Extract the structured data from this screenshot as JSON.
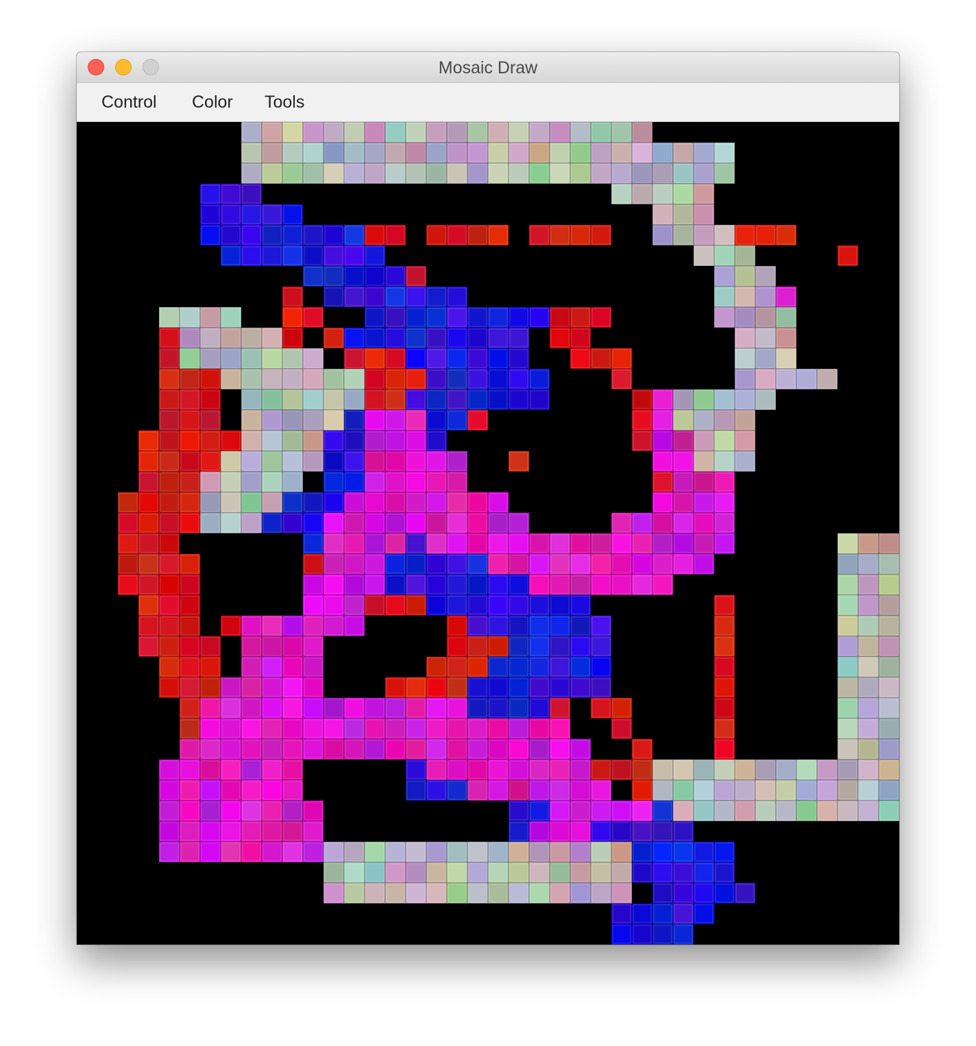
{
  "window": {
    "title": "Mosaic Draw",
    "controls": [
      "close-icon",
      "minimize-icon",
      "zoom-icon"
    ]
  },
  "menu": {
    "items": [
      {
        "label": "Control"
      },
      {
        "label": "Color"
      },
      {
        "label": "Tools"
      }
    ]
  },
  "canvas": {
    "background": "#000000",
    "grid": {
      "columns": 40,
      "rows": 40
    },
    "palettes": {
      "p": "pastel random",
      "r": "red random",
      "b": "blue random",
      "m": "magenta random"
    },
    "tile_rows": [
      "........pppppppppppppppppppp............",
      "........pppppppppppppppppppppppp........",
      "........pppppppppppppppppppppppp........",
      "......bbb.................ppppp.........",
      "......bbbbb.................ppp.........",
      "......bbbbbbbbrr.rrrr.rrrr..pppprrr.....",
      ".......bbbbbbbb...............ppp....r..",
      "...........bbbbbr..............ppp......",
      "..........r.bbbbbbb............pppm.....",
      "....pppp..rr..bbbbbbbbbrrr.....pppp.....",
      "....rpppppr.rbbbbbbbbb.rr.......ppp.....",
      "....rppppppp.rrrbbbbbb..rrr.....ppp.....",
      "....rrrppppppprrrbbbbbb...r.....ppppp...",
      "....rrr.pppppprrbbbbbbb....rmppppp......",
      "....rrr.pppppbmmmbbr.......rmpppp.......",
      "...rrrrrppppbbmmmb.........rmmppp.......",
      "...rrrrpppppbbmmmmm..r......mmppp.......",
      "...rrrppppp.bbmmmmm.........rmmm........",
      "..rrrrppppbbbmmmmmmmm.......mmmm........",
      "..rrrrpppbbbmmmmmmmmmm....mmmmmm........",
      "..rrr......bmmmmbmmmmmmmmmmmmmmm.....ppp",
      "..rrrr.....rmmmbbbbbmmmmmmmmmmm......ppp",
      "..rrrr.....mmmmbbbbbbbmmmmmmm........ppp",
      "...rrr.....mmmrrrbbbbbbbb......r.....ppp",
      "...rrr.rmmmmmm....rbbbbbbb.....r.....ppp",
      "...rrrr.mmmm......rrrbbbbb.....r.....ppp",
      "....rrr.mmmm.....rrrbbbbbb.....r.....ppp",
      "....rrrmmmmm...rrrrbbbbbbb.....r.....ppp",
      ".....rmmmmmmmmmmmmmbbbbr.rr....r.....ppp",
      ".....rmmmmmmmmmmmmmmmmmm..r....r.....ppp",
      ".....mmmmmmmmmmmmmmmmmmmm..r...r.....ppp",
      "....mmmmmmm.....bmmmmmmmmrrrppppppppppppp",
      "....mmmmmmm.....bbbmmmmmmm.rpppppppppppppp",
      "....mmmmmmmm.........bbmmmmmbpppppppppppp.",
      "....mmmmmmmm.........bmmmbbbbb..........",
      "....mmmmmmmmpppppppppppppppbbbbb........",
      "............pppppppppppppppbbbbb........",
      "............ppppppppppppppp.bbbbb.......",
      "..........................bbbbb.........",
      "..........................bbbb.........."
    ]
  }
}
